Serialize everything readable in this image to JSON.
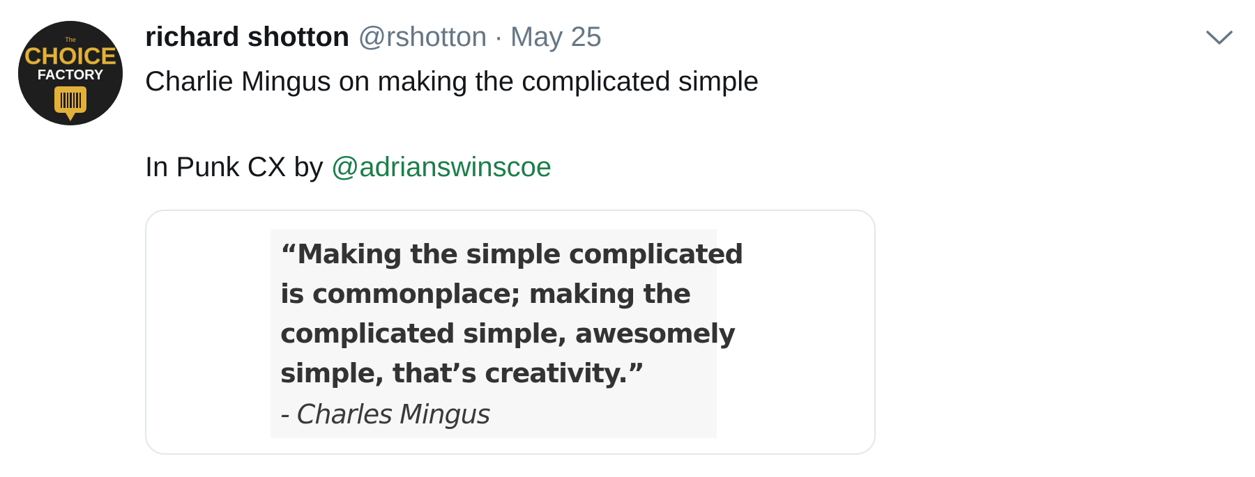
{
  "tweet": {
    "author": {
      "display_name": "richard shotton",
      "handle": "@rshotton",
      "avatar": {
        "logo_small": "The",
        "logo_line1": "CHOICE",
        "logo_line2": "FACTORY"
      }
    },
    "separator": "·",
    "date": "May 25",
    "caret_icon": "chevron-down-icon",
    "text_line1": "Charlie Mingus on making the complicated simple",
    "text_line2_prefix": "In Punk CX by ",
    "mention": "@adrianswinscoe",
    "media": {
      "quote_lines": "“Making the simple complicated\nis commonplace; making the\ncomplicated simple, awesomely\nsimple, that’s creativity.”",
      "attribution": "- Charles Mingus"
    }
  },
  "colors": {
    "text": "#14171a",
    "secondary": "#657786",
    "mention": "#1b7f4a",
    "card_border": "#e1e8ed",
    "avatar_bg": "#1e1e1e",
    "logo_gold": "#e2b13c"
  }
}
